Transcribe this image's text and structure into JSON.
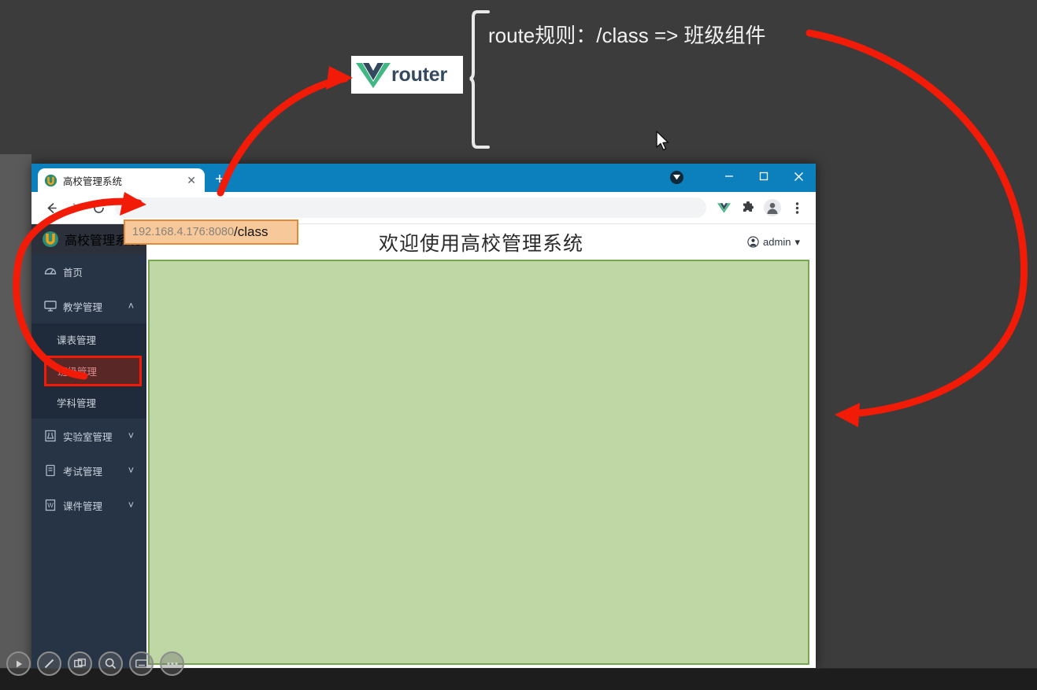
{
  "annotation": {
    "route_rule_text": "route规则：/class =>  班级组件",
    "vue_router_label": "router",
    "bracket_name": "curly-bracket",
    "arrow_color": "#f21b08"
  },
  "browser": {
    "tab": {
      "title": "高校管理系统",
      "close_label": "✕",
      "favicon_name": "site-favicon"
    },
    "new_tab_label": "+",
    "window_controls": {
      "minimize": "－",
      "maximize": "▢",
      "close": "✕"
    },
    "toolbar": {
      "back_label": "←",
      "forward_label": "→",
      "reload_label": "⟳",
      "omnibox_value": "",
      "omnibox_placeholder": "",
      "extensions": [
        "vue-devtools-icon",
        "puzzle-icon",
        "profile-avatar-icon",
        "kebab-menu-icon"
      ]
    },
    "url_highlight": {
      "host": "192.168.4.176:8080",
      "path": "/class",
      "fill": "#f6c89a",
      "border": "#e08a3c"
    },
    "titlebar_color": "#0c80bd"
  },
  "app": {
    "brand": "高校管理系统",
    "header_title": "欢迎使用高校管理系统",
    "user": {
      "name": "admin",
      "caret": "▾"
    },
    "sidebar": {
      "items": [
        {
          "label": "首页",
          "icon": "dashboard-icon",
          "chevron": "",
          "expanded": false
        },
        {
          "label": "教学管理",
          "icon": "monitor-icon",
          "chevron": "˄",
          "expanded": true
        },
        {
          "label": "实验室管理",
          "icon": "lab-icon",
          "chevron": "˅",
          "expanded": false
        },
        {
          "label": "考试管理",
          "icon": "exam-icon",
          "chevron": "˅",
          "expanded": false
        },
        {
          "label": "课件管理",
          "icon": "courseware-icon",
          "chevron": "˅",
          "expanded": false
        }
      ],
      "submenu": [
        {
          "label": "课表管理",
          "highlighted": false
        },
        {
          "label": "班级管理",
          "highlighted": true
        },
        {
          "label": "学科管理",
          "highlighted": false
        }
      ]
    },
    "router_view": {
      "fill": "#bed7a5",
      "border": "#77a551",
      "content": ""
    }
  },
  "recorder": {
    "buttons": [
      {
        "name": "play-icon"
      },
      {
        "name": "pen-icon"
      },
      {
        "name": "window-capture-icon"
      },
      {
        "name": "magnifier-icon"
      },
      {
        "name": "keyboard-icon"
      },
      {
        "name": "more-ellipsis-icon"
      }
    ]
  }
}
